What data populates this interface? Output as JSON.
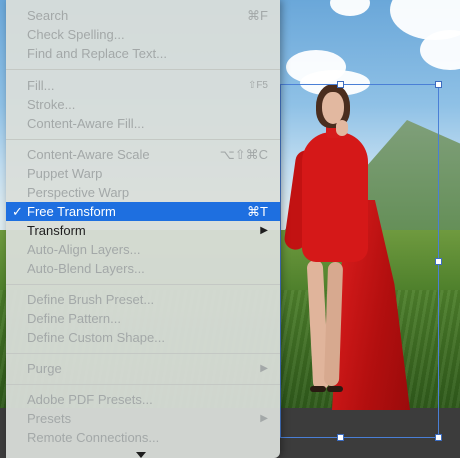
{
  "menu": {
    "items": [
      {
        "label": "Search",
        "shortcut": "⌘F",
        "enabled": false
      },
      {
        "label": "Check Spelling...",
        "shortcut": "",
        "enabled": false
      },
      {
        "label": "Find and Replace Text...",
        "shortcut": "",
        "enabled": false
      },
      {
        "label": "Fill...",
        "shortcut": "⇧F5",
        "enabled": false
      },
      {
        "label": "Stroke...",
        "shortcut": "",
        "enabled": false
      },
      {
        "label": "Content-Aware Fill...",
        "shortcut": "",
        "enabled": false
      },
      {
        "label": "Content-Aware Scale",
        "shortcut": "⌥⇧⌘C",
        "enabled": false
      },
      {
        "label": "Puppet Warp",
        "shortcut": "",
        "enabled": false
      },
      {
        "label": "Perspective Warp",
        "shortcut": "",
        "enabled": false
      },
      {
        "label": "Free Transform",
        "shortcut": "⌘T",
        "enabled": true,
        "selected": true,
        "checked": true,
        "check_glyph": "✓"
      },
      {
        "label": "Transform",
        "shortcut": "",
        "enabled": true,
        "submenu": true,
        "arrow_glyph": "▶"
      },
      {
        "label": "Auto-Align Layers...",
        "shortcut": "",
        "enabled": false
      },
      {
        "label": "Auto-Blend Layers...",
        "shortcut": "",
        "enabled": false
      },
      {
        "label": "Define Brush Preset...",
        "shortcut": "",
        "enabled": false
      },
      {
        "label": "Define Pattern...",
        "shortcut": "",
        "enabled": false
      },
      {
        "label": "Define Custom Shape...",
        "shortcut": "",
        "enabled": false
      },
      {
        "label": "Purge",
        "shortcut": "",
        "enabled": false,
        "submenu": true,
        "arrow_glyph": "▶"
      },
      {
        "label": "Adobe PDF Presets...",
        "shortcut": "",
        "enabled": false
      },
      {
        "label": "Presets",
        "shortcut": "",
        "enabled": false,
        "submenu": true,
        "arrow_glyph": "▶"
      },
      {
        "label": "Remote Connections...",
        "shortcut": "",
        "enabled": false
      }
    ]
  },
  "colors": {
    "menu_bg": "#dadeda",
    "selected_bg": "#1e6fe0",
    "enabled_text": "#1e1e1e",
    "disabled_text": "#a3a8a8",
    "transform_box": "#4a7fd6",
    "dress": "#d51818"
  },
  "icons": {
    "check": "check-icon",
    "submenu": "chevron-right-icon",
    "scroll_down": "scroll-down-arrow-icon"
  }
}
